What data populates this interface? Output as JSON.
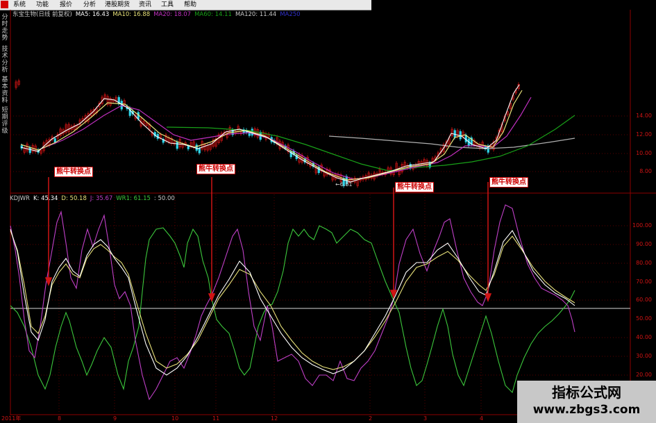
{
  "menubar": {
    "logo_icon": "app-logo-icon",
    "items": [
      "系统",
      "功能",
      "报价",
      "分析",
      "港股期货",
      "资讯",
      "工具",
      "帮助"
    ]
  },
  "side_tabs": [
    "分时走势",
    "技术分析",
    "基本资料",
    "短期评级"
  ],
  "main_legend": {
    "title": "东宝生物(日线 前复权)",
    "ma5": "MA5: 16.43",
    "ma10": "MA10: 16.88",
    "ma20": "MA20: 18.07",
    "ma60": "MA60: 14.11",
    "ma120": "MA120: 11.44",
    "extra": "MA250"
  },
  "kdjwr_legend": {
    "name": "KDJWR",
    "k": "K: 45.34",
    "d": "D: 50.18",
    "j": "J: 35.67",
    "wr1": "WR1: 61.15",
    "level": ": 50.00"
  },
  "price_axis": [
    "14.00",
    "12.00",
    "10.00",
    "8.00"
  ],
  "indicator_axis": [
    "100.00",
    "90.00",
    "80.00",
    "70.00",
    "60.00",
    "50.00",
    "40.00",
    "30.00",
    "20.00"
  ],
  "time_axis": [
    "2011年",
    "8",
    "9",
    "10",
    "11",
    "12",
    "2",
    "3",
    "4"
  ],
  "low_marker": "←6.81",
  "callouts": [
    "熊牛转换点",
    "熊牛转换点",
    "熊牛转换点",
    "熊牛转换点"
  ],
  "watermark": {
    "title": "指标公式网",
    "url": "www.zbgs3.com"
  },
  "colors": {
    "up": "#d01414",
    "down": "#2fd4e8",
    "ma5": "#ffffff",
    "ma10": "#e8e27a",
    "ma20": "#c030c0",
    "ma60": "#18a018",
    "ma120": "#b0b0b0",
    "k": "#ffffff",
    "d": "#e8e27a",
    "j": "#c040c8",
    "wr": "#3cc83c",
    "grid": "#8b0000",
    "arrow": "#d01414"
  }
}
